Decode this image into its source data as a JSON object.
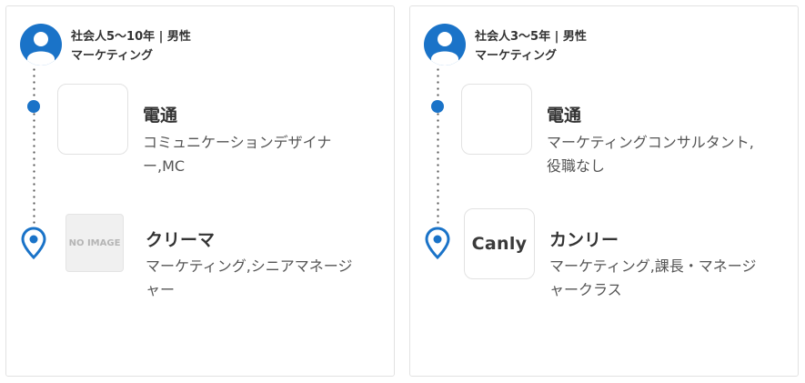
{
  "cards": [
    {
      "profile_line1": "社会人5〜10年 | 男性",
      "profile_line2": "マーケティング",
      "career": [
        {
          "company": "電通",
          "role_line1": "コミュニケーションデザイナ",
          "role_line2": "ー,MC",
          "logo_text": ""
        },
        {
          "company": "クリーマ",
          "role_line1": "マーケティング,シニアマネージ",
          "role_line2": "ャー",
          "logo_text": "NO IMAGE"
        }
      ]
    },
    {
      "profile_line1": "社会人3〜5年 | 男性",
      "profile_line2": "マーケティング",
      "career": [
        {
          "company": "電通",
          "role_line1": "マーケティングコンサルタント,",
          "role_line2": "役職なし",
          "logo_text": ""
        },
        {
          "company": "カンリー",
          "role_line1": "マーケティング,課長・マネージ",
          "role_line2": "ャークラス",
          "logo_text": "Canly"
        }
      ]
    }
  ],
  "icons": {
    "avatar": "user-avatar-icon",
    "timeline_dot": "dot-icon",
    "location": "map-pin-icon"
  },
  "colors": {
    "accent": "#1a73c8",
    "border": "#e2e2e2",
    "text": "#333333"
  }
}
